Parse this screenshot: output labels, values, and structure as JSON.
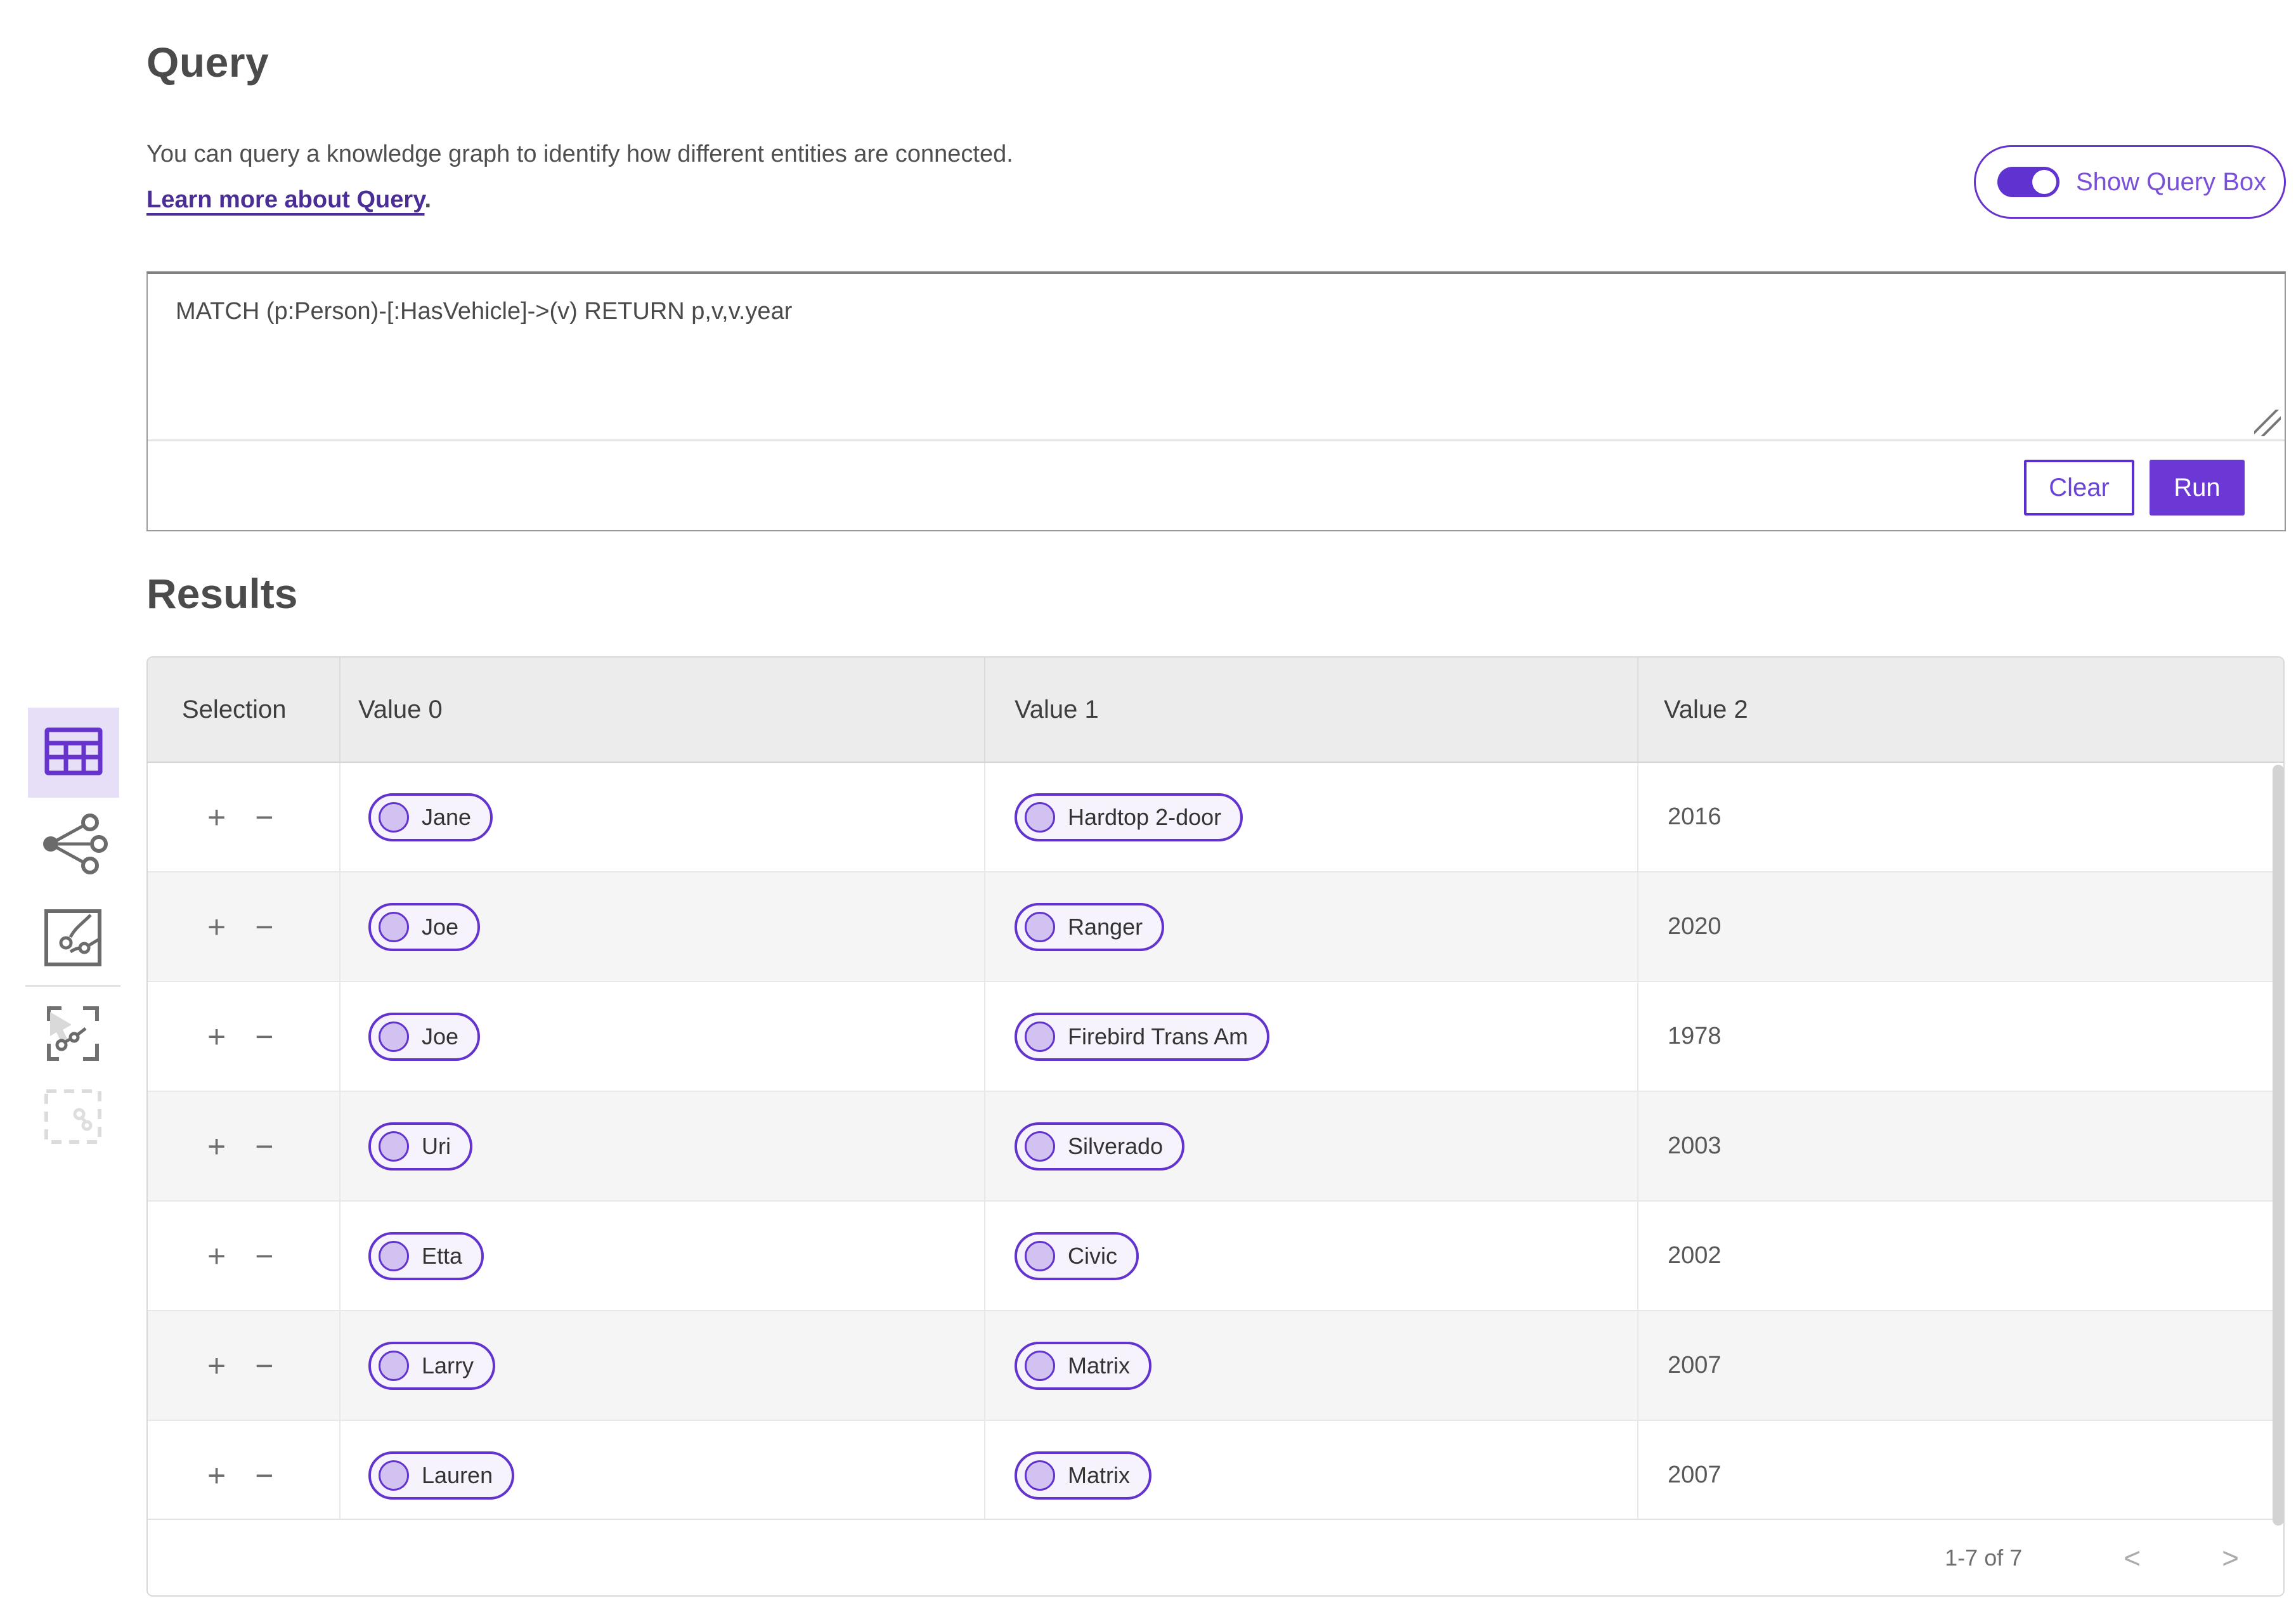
{
  "colors": {
    "accent_purple": "#6633cc",
    "run_button_fill": "#6b38d6",
    "link_purple": "#4a2d96",
    "selected_tile_bg": "#e7def8",
    "pill_bg": "#f6f3fc",
    "pill_circle_fill": "#d2c2f2",
    "header_row_bg": "#ececec",
    "alt_row_bg": "#f5f5f5"
  },
  "header": {
    "title": "Query",
    "description": "You can query a knowledge graph to identify how different entities are connected.",
    "learn_more": "Learn more about Query",
    "learn_more_suffix": ".",
    "show_query_box_label": "Show Query Box"
  },
  "query_panel": {
    "query_text": "MATCH (p:Person)-[:HasVehicle]->(v) RETURN p,v,v.year",
    "clear_label": "Clear",
    "run_label": "Run"
  },
  "results": {
    "title": "Results",
    "columns": [
      "Selection",
      "Value 0",
      "Value 1",
      "Value 2"
    ],
    "row_controls": {
      "add": "+",
      "remove": "−"
    },
    "rows": [
      {
        "value0": "Jane",
        "value1": "Hardtop 2-door",
        "value2": "2016"
      },
      {
        "value0": "Joe",
        "value1": "Ranger",
        "value2": "2020"
      },
      {
        "value0": "Joe",
        "value1": "Firebird Trans Am",
        "value2": "1978"
      },
      {
        "value0": "Uri",
        "value1": "Silverado",
        "value2": "2003"
      },
      {
        "value0": "Etta",
        "value1": "Civic",
        "value2": "2002"
      },
      {
        "value0": "Larry",
        "value1": "Matrix",
        "value2": "2007"
      },
      {
        "value0": "Lauren",
        "value1": "Matrix",
        "value2": "2007"
      }
    ],
    "pagination": {
      "range_label": "1-7 of 7",
      "prev": "<",
      "next": ">"
    }
  },
  "sidebar": {
    "items": [
      {
        "icon": "table-icon",
        "selected": true,
        "disabled": false
      },
      {
        "icon": "graph-icon",
        "selected": false,
        "disabled": false
      },
      {
        "icon": "map-icon",
        "selected": false,
        "disabled": false
      },
      {
        "icon": "graph-select-icon",
        "selected": false,
        "disabled": false
      },
      {
        "icon": "selection-icon",
        "selected": false,
        "disabled": true
      }
    ]
  }
}
